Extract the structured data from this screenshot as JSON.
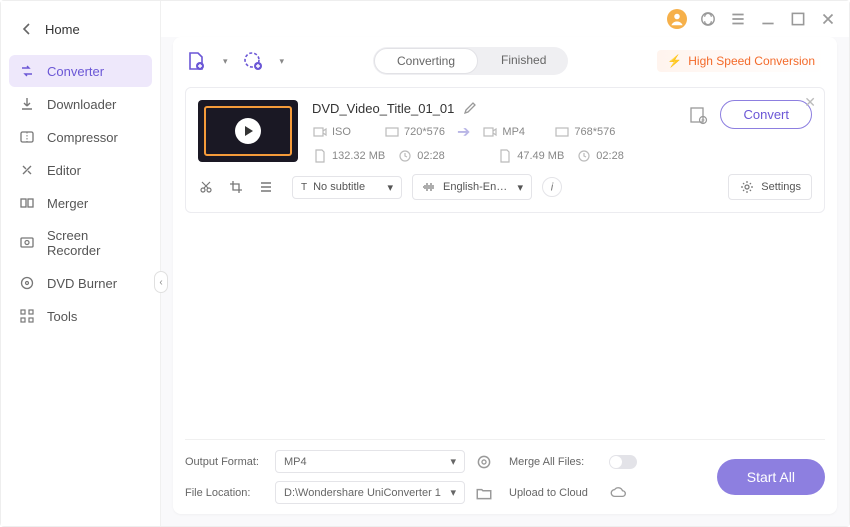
{
  "sidebar": {
    "home": "Home",
    "items": [
      {
        "label": "Converter"
      },
      {
        "label": "Downloader"
      },
      {
        "label": "Compressor"
      },
      {
        "label": "Editor"
      },
      {
        "label": "Merger"
      },
      {
        "label": "Screen Recorder"
      },
      {
        "label": "DVD Burner"
      },
      {
        "label": "Tools"
      }
    ]
  },
  "tabs": {
    "converting": "Converting",
    "finished": "Finished"
  },
  "banner": {
    "high_speed": "High Speed Conversion"
  },
  "item": {
    "title": "DVD_Video_Title_01_01",
    "src": {
      "format": "ISO",
      "res": "720*576",
      "size": "132.32 MB",
      "dur": "02:28"
    },
    "dst": {
      "format": "MP4",
      "res": "768*576",
      "size": "47.49 MB",
      "dur": "02:28"
    },
    "convert_label": "Convert",
    "subtitle": "No subtitle",
    "audio": "English-English...",
    "settings": "Settings"
  },
  "footer": {
    "output_format_label": "Output Format:",
    "output_format": "MP4",
    "file_location_label": "File Location:",
    "file_location": "D:\\Wondershare UniConverter 1",
    "merge_label": "Merge All Files:",
    "upload_label": "Upload to Cloud",
    "start_all": "Start All"
  }
}
